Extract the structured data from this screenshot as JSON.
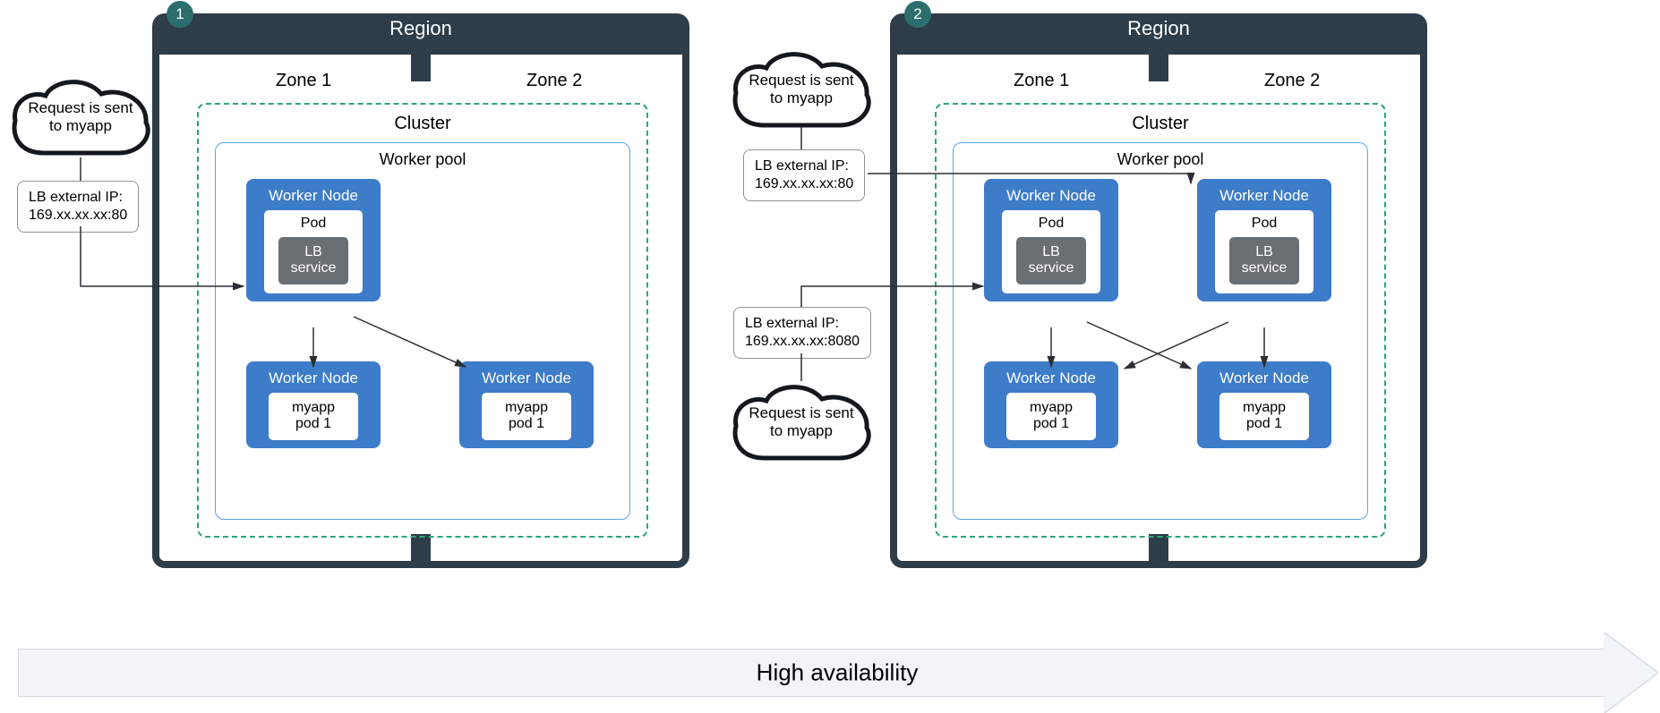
{
  "badges": {
    "one": "1",
    "two": "2"
  },
  "region_title": "Region",
  "zones": {
    "z1": "Zone 1",
    "z2": "Zone 2"
  },
  "cluster_title": "Cluster",
  "worker_pool_title": "Worker pool",
  "worker_node_title": "Worker Node",
  "pod_title": "Pod",
  "lb_service_line1": "LB",
  "lb_service_line2": "service",
  "myapp_line1": "myapp",
  "myapp_line2": "pod 1",
  "cloud_line1": "Request is sent",
  "cloud_line2": "to myapp",
  "lb_ip_line1": "LB external IP:",
  "lb_ip_80": "169.xx.xx.xx:80",
  "lb_ip_8080": "169.xx.xx.xx:8080",
  "ha_label": "High availability"
}
